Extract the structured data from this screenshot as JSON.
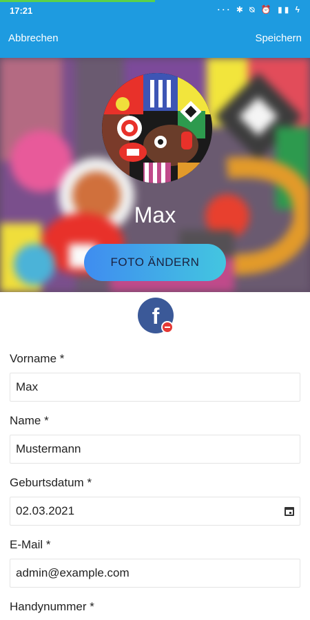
{
  "status_bar": {
    "time": "17:21",
    "icons": "··· ✱ ⍉ ⏰ ▮▮ ϟ",
    "loading_progress": 0.5
  },
  "app_bar": {
    "cancel_label": "Abbrechen",
    "save_label": "Speichern",
    "background_color": "#1e9be0"
  },
  "profile": {
    "name": "Max",
    "change_photo_label": "FOTO ÄNDERN",
    "linked_account": "facebook-icon"
  },
  "form": {
    "fields": [
      {
        "label": "Vorname *",
        "value": "Max"
      },
      {
        "label": "Name *",
        "value": "Mustermann"
      },
      {
        "label": "Geburtsdatum *",
        "value": "02.03.2021"
      },
      {
        "label": "E-Mail *",
        "value": "admin@example.com"
      },
      {
        "label": "Handynummer *",
        "value": ""
      }
    ]
  }
}
